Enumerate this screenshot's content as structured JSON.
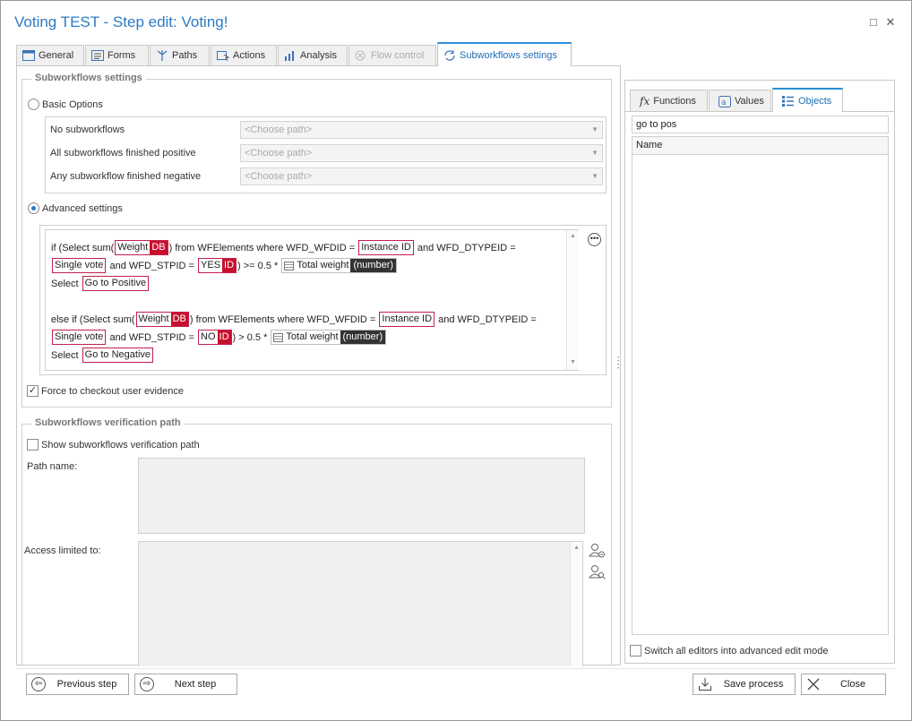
{
  "window": {
    "title": "Voting TEST - Step edit: Voting!",
    "maximize_glyph": "□",
    "close_glyph": "✕"
  },
  "tabs": [
    {
      "label": "General",
      "icon": "general-icon"
    },
    {
      "label": "Forms",
      "icon": "forms-icon"
    },
    {
      "label": "Paths",
      "icon": "paths-icon"
    },
    {
      "label": "Actions",
      "icon": "actions-icon"
    },
    {
      "label": "Analysis",
      "icon": "analysis-icon"
    },
    {
      "label": "Flow control",
      "icon": "flow-control-icon",
      "disabled": true
    },
    {
      "label": "Subworkflows settings",
      "icon": "subworkflows-icon",
      "active": true
    }
  ],
  "subworkflows_settings": {
    "group_title": "Subworkflows settings",
    "basic_options_label": "Basic Options",
    "basic_rows": [
      {
        "label": "No subworkflows",
        "placeholder": "<Choose path>"
      },
      {
        "label": "All subworkflows finished positive",
        "placeholder": "<Choose path>"
      },
      {
        "label": "Any subworkflow finished negative",
        "placeholder": "<Choose path>"
      }
    ],
    "advanced_settings_label": "Advanced settings",
    "selected_mode": "advanced",
    "code": {
      "l1_a": "if (Select sum(",
      "weight": "Weight",
      "db": "DB",
      "l1_b": ") from WFElements where WFD_WFDID =",
      "instance_id": "Instance ID",
      "l1_c": "and WFD_DTYPEID =",
      "single_vote": "Single vote",
      "l2_a": "and WFD_STPID =",
      "yes": "YES",
      "id": "ID",
      "l2_b_pos": ") >= 0.5 *",
      "total_weight": "Total weight",
      "number": "(number)",
      "select": "Select",
      "go_positive": "Go to Positive",
      "l5_a": "else if (Select sum(",
      "no": "NO",
      "l6_b_neg": ") > 0.5 *",
      "go_negative": "Go to Negative"
    },
    "force_checkout_label": "Force to checkout user evidence",
    "force_checkout_checked": true
  },
  "verification": {
    "group_title": "Subworkflows verification path",
    "show_label": "Show subworkflows verification path",
    "show_checked": false,
    "path_name_label": "Path name:",
    "access_label": "Access limited to:"
  },
  "right_panel": {
    "tabs": [
      {
        "label": "Functions",
        "icon": "fx-icon"
      },
      {
        "label": "Values",
        "icon": "values-icon"
      },
      {
        "label": "Objects",
        "icon": "objects-icon",
        "active": true
      }
    ],
    "search_value": "go to pos",
    "column_header": "Name",
    "switch_label": "Switch all editors into advanced edit mode",
    "switch_checked": false
  },
  "footer": {
    "previous_label": "Previous step",
    "next_label": "Next step",
    "save_label": "Save process",
    "close_label": "Close"
  },
  "colors": {
    "accent": "#2b7bc4",
    "token_border": "#c4204a",
    "token_tag": "#c8102e",
    "number_tag": "#333333"
  }
}
